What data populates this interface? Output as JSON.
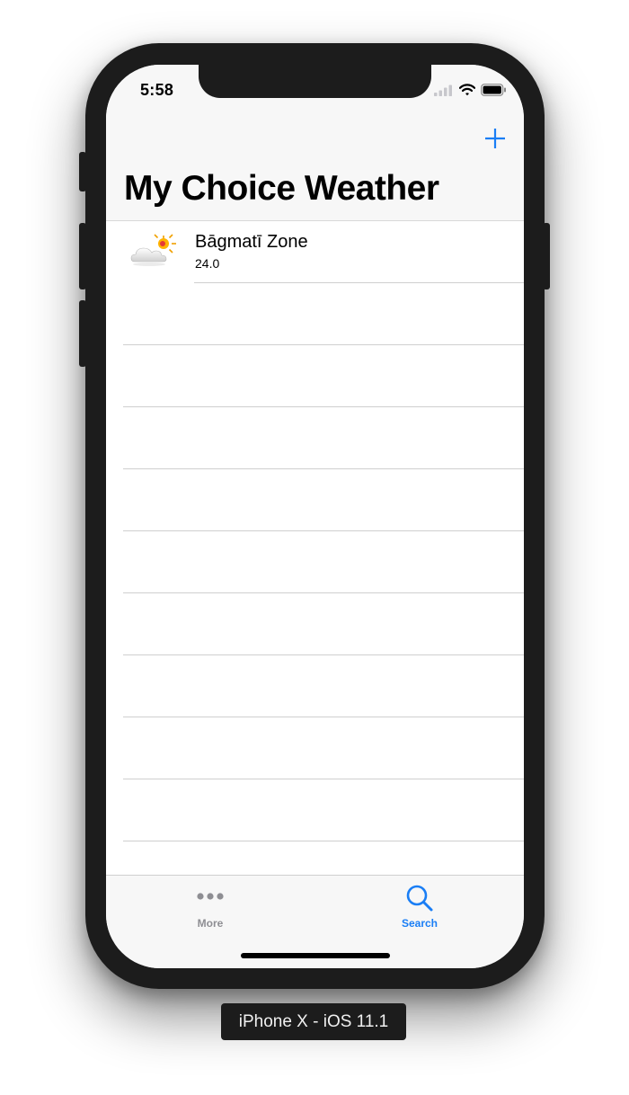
{
  "device_label": "iPhone X - iOS 11.1",
  "status_bar": {
    "time": "5:58",
    "icons": [
      "cellular-signal-icon",
      "wifi-icon",
      "battery-icon"
    ]
  },
  "nav": {
    "title": "My Choice Weather",
    "add_icon": "plus-icon"
  },
  "list": {
    "items": [
      {
        "title": "Bāgmatī Zone",
        "subtitle": "24.0",
        "icon": "partly-cloudy-icon"
      }
    ]
  },
  "tab_bar": {
    "tabs": [
      {
        "label": "More",
        "icon": "more-icon",
        "selected": false
      },
      {
        "label": "Search",
        "icon": "search-icon",
        "selected": true
      }
    ]
  },
  "colors": {
    "accent": "#1a7ef5",
    "inactive": "#8e8e93",
    "device": "#1c1c1c"
  }
}
